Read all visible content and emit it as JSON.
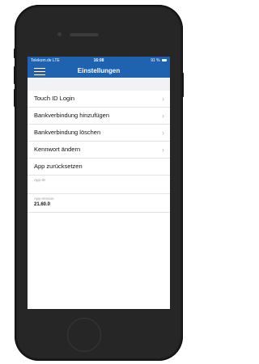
{
  "status_bar": {
    "carrier": "Telekom.de LTE",
    "time": "16:08",
    "battery": "91 %"
  },
  "header": {
    "title": "Einstellungen"
  },
  "menu": [
    {
      "label": "Touch ID Login"
    },
    {
      "label": "Bankverbindung hinzufügen"
    },
    {
      "label": "Bankverbindung löschen"
    },
    {
      "label": "Kennwort ändern"
    },
    {
      "label": "App zurücksetzen"
    }
  ],
  "app_id": {
    "label": "App-ID",
    "value": ""
  },
  "app_version": {
    "label": "App-Version",
    "value": "21.60.0"
  },
  "colors": {
    "primary": "#1e62b0",
    "background": "#f2f2f4"
  }
}
